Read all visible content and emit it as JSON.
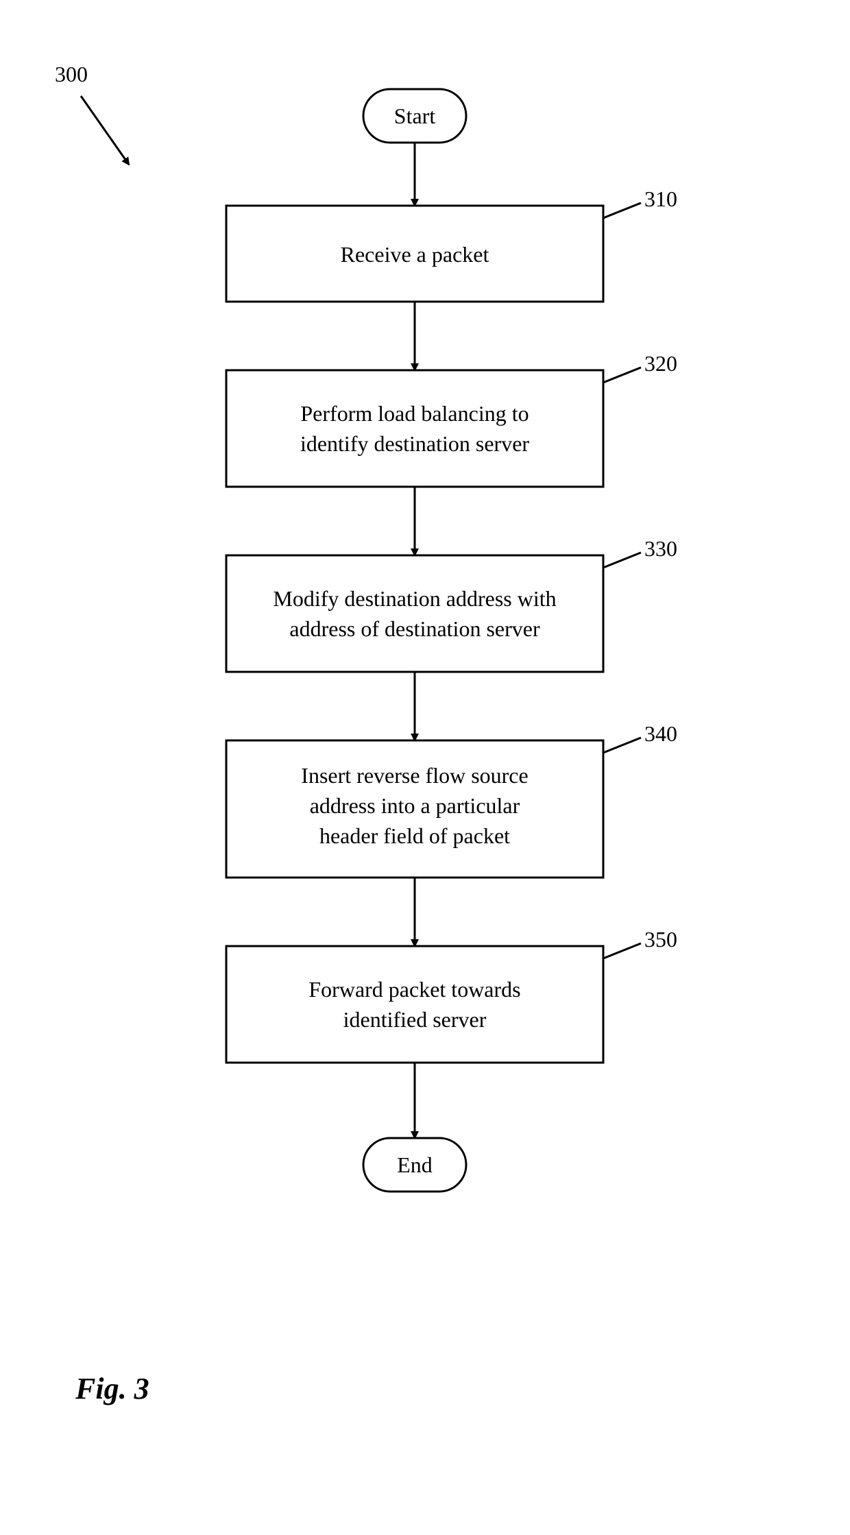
{
  "chart_data": {
    "type": "flowchart",
    "nodes": [
      {
        "id": "start",
        "kind": "terminator",
        "label": "Start"
      },
      {
        "id": "n310",
        "kind": "process",
        "ref": "310",
        "label": "Receive a packet"
      },
      {
        "id": "n320",
        "kind": "process",
        "ref": "320",
        "label": "Perform load balancing to identify destination server"
      },
      {
        "id": "n330",
        "kind": "process",
        "ref": "330",
        "label": "Modify destination address with address of destination server"
      },
      {
        "id": "n340",
        "kind": "process",
        "ref": "340",
        "label": "Insert reverse flow source address into a particular header field of packet"
      },
      {
        "id": "n350",
        "kind": "process",
        "ref": "350",
        "label": "Forward packet towards identified server"
      },
      {
        "id": "end",
        "kind": "terminator",
        "label": "End"
      }
    ],
    "edges": [
      [
        "start",
        "n310"
      ],
      [
        "n310",
        "n320"
      ],
      [
        "n320",
        "n330"
      ],
      [
        "n330",
        "n340"
      ],
      [
        "n340",
        "n350"
      ],
      [
        "n350",
        "end"
      ]
    ]
  },
  "nodes": {
    "start": {
      "label": "Start"
    },
    "n310": {
      "label_l1": "Receive a packet"
    },
    "n320": {
      "label_l1": "Perform load balancing to",
      "label_l2": "identify destination server"
    },
    "n330": {
      "label_l1": "Modify destination address with",
      "label_l2": "address of destination server"
    },
    "n340": {
      "label_l1": "Insert reverse flow source",
      "label_l2": "address into a particular",
      "label_l3": "header field of packet"
    },
    "n350": {
      "label_l1": "Forward packet towards",
      "label_l2": "identified server"
    },
    "end": {
      "label": "End"
    }
  },
  "refs": {
    "diagram": "300",
    "n310": "310",
    "n320": "320",
    "n330": "330",
    "n340": "340",
    "n350": "350"
  },
  "figure_label": "Fig. 3"
}
